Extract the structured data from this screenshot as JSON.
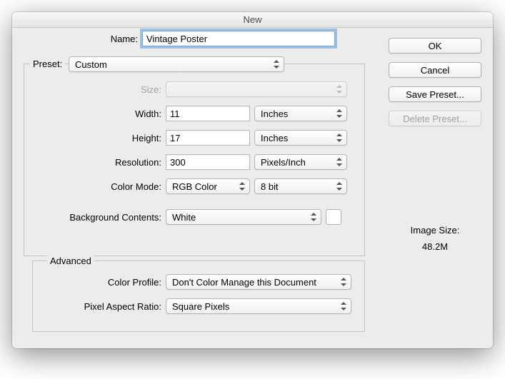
{
  "window": {
    "title": "New"
  },
  "labels": {
    "name": "Name:",
    "preset": "Preset:",
    "size": "Size:",
    "width": "Width:",
    "height": "Height:",
    "resolution": "Resolution:",
    "color_mode": "Color Mode:",
    "bg_contents": "Background Contents:",
    "advanced": "Advanced",
    "color_profile": "Color Profile:",
    "pixel_aspect": "Pixel Aspect Ratio:"
  },
  "fields": {
    "name": "Vintage Poster",
    "preset": "Custom",
    "size": "",
    "width": "11",
    "width_unit": "Inches",
    "height": "17",
    "height_unit": "Inches",
    "resolution": "300",
    "resolution_unit": "Pixels/Inch",
    "color_mode": "RGB Color",
    "bit_depth": "8 bit",
    "bg_contents": "White",
    "color_profile": "Don't Color Manage this Document",
    "pixel_aspect": "Square Pixels"
  },
  "buttons": {
    "ok": "OK",
    "cancel": "Cancel",
    "save_preset": "Save Preset...",
    "delete_preset": "Delete Preset..."
  },
  "info": {
    "image_size_label": "Image Size:",
    "image_size_value": "48.2M"
  }
}
